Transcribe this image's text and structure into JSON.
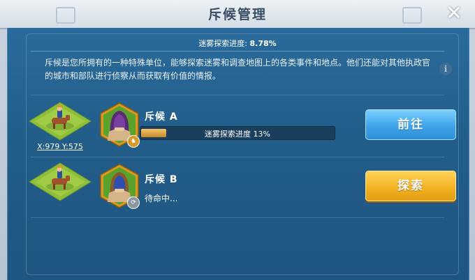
{
  "window": {
    "title": "斥候管理",
    "close_symbol": "✕"
  },
  "exploration": {
    "label": "迷雾探索进度: ",
    "percent": "8.78%"
  },
  "description": "斥候是您所拥有的一种特殊单位，能够探索迷雾和调查地图上的各类事件和地点。他们还能对其他执政官的城市和部队进行侦察从而获取有价值的情报。",
  "info_icon": "i",
  "scouts": [
    {
      "name": "斥候  A",
      "coords": "X:979 Y:575",
      "progress_text": "迷雾探索进度 13%",
      "progress_value": 13,
      "button_label": "前往",
      "badge_icon": "horse-icon"
    },
    {
      "name": "斥候  B",
      "status": "待命中...",
      "button_label": "探索",
      "badge_icon": "idle-icon"
    }
  ],
  "colors": {
    "panel": "#225d89",
    "go_button": "#3ea4ea",
    "explore_button": "#f2b324",
    "progress_fill": "#e0a43e"
  }
}
